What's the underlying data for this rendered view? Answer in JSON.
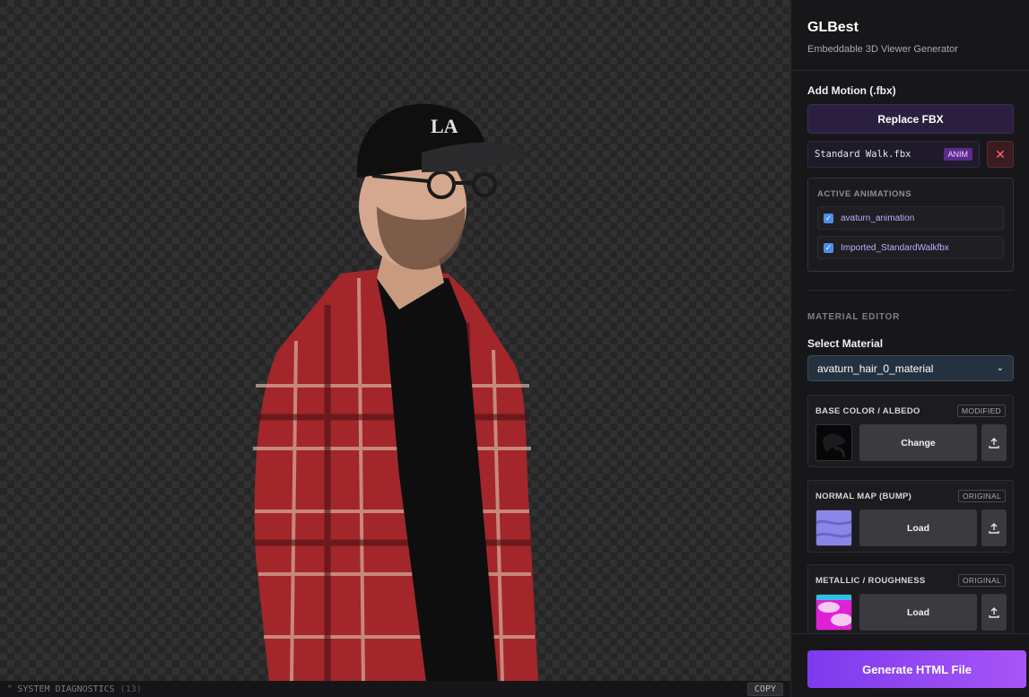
{
  "app": {
    "title": "GLBest",
    "subtitle": "Embeddable 3D Viewer Generator"
  },
  "motion": {
    "label": "Add Motion (.fbx)",
    "replace_button": "Replace FBX",
    "file_name": "Standard Walk.fbx",
    "file_badge": "ANIM",
    "remove_icon": "close-icon"
  },
  "animations": {
    "title": "ACTIVE ANIMATIONS",
    "items": [
      {
        "name": "avaturn_animation",
        "checked": true
      },
      {
        "name": "Imported_StandardWalkfbx",
        "checked": true
      }
    ]
  },
  "material_editor": {
    "title": "MATERIAL EDITOR",
    "select_label": "Select Material",
    "selected_material": "avaturn_hair_0_material",
    "maps": [
      {
        "label": "BASE COLOR / ALBEDO",
        "status": "MODIFIED",
        "action": "Change"
      },
      {
        "label": "NORMAL MAP (BUMP)",
        "status": "ORIGINAL",
        "action": "Load"
      },
      {
        "label": "METALLIC / ROUGHNESS",
        "status": "ORIGINAL",
        "action": "Load"
      }
    ]
  },
  "generate_button": "Generate HTML File",
  "diagnostics": {
    "label": "SYSTEM DIAGNOSTICS",
    "count": "(13)",
    "copy_button": "COPY"
  },
  "colors": {
    "accent": "#7c3aed",
    "accent_light": "#a855f7",
    "checkbox": "#4a8fe7",
    "danger": "#ff6b6b",
    "panel_bg": "#17171a"
  }
}
